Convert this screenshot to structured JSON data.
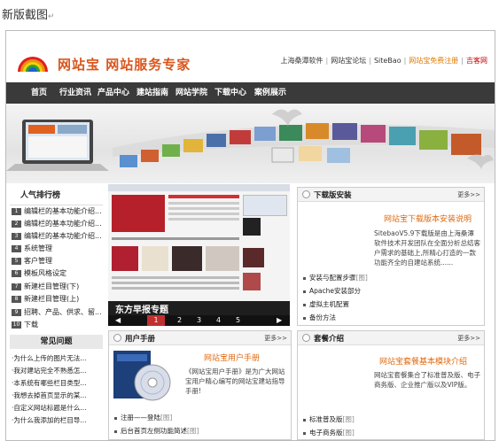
{
  "caption": {
    "text": "新版截图",
    "mark": "↵"
  },
  "header": {
    "brand": "网站宝 网站服务专家",
    "links": [
      "上海桑潭软件",
      "网站宝论坛",
      "SiteBao",
      "网站宝免费注册",
      "吉客网"
    ]
  },
  "nav": {
    "items": [
      "首页",
      "行业资讯",
      "产品中心",
      "建站指南",
      "网站学院",
      "下载中心",
      "案例展示"
    ]
  },
  "ranking": {
    "title": "人气排行榜",
    "items": [
      {
        "num": "1",
        "text": "编辑栏的基本功能介绍..."
      },
      {
        "num": "2",
        "text": "编辑栏的基本功能介绍..."
      },
      {
        "num": "3",
        "text": "编辑栏的基本功能介绍..."
      },
      {
        "num": "4",
        "text": "系统管理"
      },
      {
        "num": "5",
        "text": "客户管理"
      },
      {
        "num": "6",
        "text": "模板风格设定"
      },
      {
        "num": "7",
        "text": "新建栏目管理(下)"
      },
      {
        "num": "8",
        "text": "新建栏目管理(上)"
      },
      {
        "num": "9",
        "text": "招聘、产品、供求、留..."
      },
      {
        "num": "10",
        "text": "下载"
      }
    ]
  },
  "faq": {
    "title": "常见问题",
    "items": [
      "·为什么上传的图片无法...",
      "·我对建站完全不熟悉怎...",
      "·本系统有哪些栏目类型...",
      "·我想去掉首页显示的某...",
      "·自定义网站标题是什么...",
      "·为什么我添加的栏目导..."
    ]
  },
  "slideshow": {
    "caption": "东方早报专题",
    "pages": [
      "1",
      "2",
      "3",
      "4",
      "5"
    ]
  },
  "download_panel": {
    "title": "下载版安装",
    "more": "更多>>",
    "heading": "网站宝下载版本安装说明",
    "desc": "SitebaoV5.9下载版是由上海桑潭软件技术开发团队在全面分析总结客户需求的基础上,所精心打造的一款功能齐全的自建站系统......",
    "items": [
      {
        "text": "安装与配置步骤",
        "tag": "[图]"
      },
      {
        "text": "Apache安装部分",
        "tag": ""
      },
      {
        "text": "虚拟主机配置",
        "tag": ""
      },
      {
        "text": "备份方法",
        "tag": ""
      }
    ]
  },
  "manual_panel": {
    "title": "用户手册",
    "more": "更多>>",
    "heading": "网站宝用户手册",
    "desc": "《网站宝用户手册》是为广大网站宝用户精心编写的网站宝建站指导手册!",
    "items": [
      {
        "text": "注册——登陆",
        "tag": "[图]"
      },
      {
        "text": "后台首页左侧功能简述",
        "tag": "[图]"
      }
    ]
  },
  "package_panel": {
    "title": "套餐介绍",
    "more": "更多>>",
    "heading": "网站宝套餐基本模块介绍",
    "desc": "网站宝套餐集合了标准普及版、电子商务版、企业推广版以及VIP版。",
    "items": [
      {
        "text": "标准普及版",
        "tag": "[图]"
      },
      {
        "text": "电子商务版",
        "tag": "[图]"
      }
    ]
  },
  "colors": {
    "nav_bg": "#3a3a3a",
    "brand": "#d9561d",
    "accent_orange": "#e06a10"
  }
}
